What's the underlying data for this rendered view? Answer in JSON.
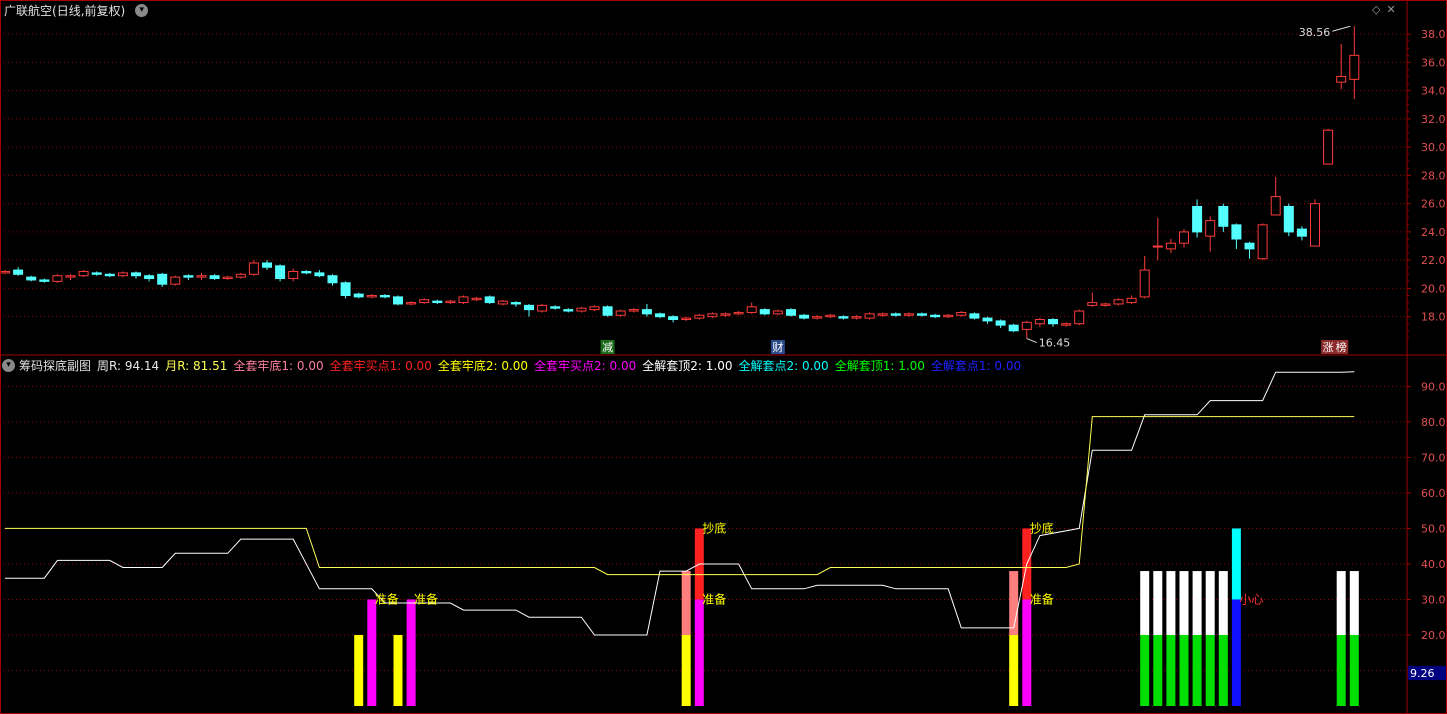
{
  "main_panel": {
    "title": "广联航空",
    "period": "(日线,前复权)",
    "max_label": "38.56",
    "min_label": "16.45",
    "markers": [
      {
        "text": "减",
        "bg": "#1a6b1a",
        "fg": "#ffffff",
        "index": 46
      },
      {
        "text": "财",
        "bg": "#2a4a8a",
        "fg": "#ffffff",
        "index": 59
      },
      {
        "text": "涨",
        "bg": "#8a2a2a",
        "fg": "#ffffff",
        "index": 101
      },
      {
        "text": "榜",
        "bg": "#8a2a2a",
        "fg": "#ffffff",
        "index": 102
      }
    ],
    "y_ticks": [
      "38.0",
      "36.0",
      "34.0",
      "32.0",
      "30.0",
      "28.0",
      "26.0",
      "24.0",
      "22.0",
      "20.0",
      "18.0"
    ]
  },
  "sub_panel": {
    "title": "筹码探底副图",
    "metrics": [
      {
        "label": "周R: 94.14",
        "color": "#e8e8e8"
      },
      {
        "label": "月R: 81.51",
        "color": "#ffff55"
      },
      {
        "label": "全套牢底1: 0.00",
        "color": "#ff7f9f"
      },
      {
        "label": "全套牢买点1: 0.00",
        "color": "#ff2020"
      },
      {
        "label": "全套牢底2: 0.00",
        "color": "#ffff00"
      },
      {
        "label": "全套牢买点2: 0.00",
        "color": "#ff00ff"
      },
      {
        "label": "全解套顶2: 1.00",
        "color": "#ffffff"
      },
      {
        "label": "全解套点2: 0.00",
        "color": "#00ffff"
      },
      {
        "label": "全解套顶1: 1.00",
        "color": "#00ff00"
      },
      {
        "label": "全解套点1: 0.00",
        "color": "#2020ff"
      }
    ],
    "y_ticks": [
      "90.0",
      "80.0",
      "70.0",
      "60.0",
      "50.0",
      "40.0",
      "30.0",
      "20.0"
    ],
    "current_value": "9.26",
    "annotations": [
      {
        "text": "准备",
        "index": 28,
        "y": 30,
        "color": "#ffff00"
      },
      {
        "text": "准备",
        "index": 31,
        "y": 30,
        "color": "#ffff00"
      },
      {
        "text": "抄底",
        "index": 53,
        "y": 50,
        "color": "#ffff00"
      },
      {
        "text": "准备",
        "index": 53,
        "y": 30,
        "color": "#ffff00"
      },
      {
        "text": "抄底",
        "index": 78,
        "y": 50,
        "color": "#ffff00"
      },
      {
        "text": "准备",
        "index": 78,
        "y": 30,
        "color": "#ffff00"
      },
      {
        "text": "小心",
        "index": 94,
        "y": 30,
        "color": "#ff3030"
      }
    ]
  },
  "colors": {
    "up": "#ff3b3b",
    "down": "#54ffff",
    "grid": "#8b0000",
    "axis_text": "#e05050",
    "white_line": "#ffffff",
    "yellow_line": "#ffff55"
  },
  "chart_data": {
    "type": "candlestick",
    "price_ylim": [
      15.5,
      39.0
    ],
    "candles": [
      [
        21.1,
        21.2,
        21.0,
        21.3
      ],
      [
        21.3,
        21.0,
        20.9,
        21.5
      ],
      [
        20.8,
        20.6,
        20.5,
        20.9
      ],
      [
        20.6,
        20.5,
        20.4,
        20.7
      ],
      [
        20.5,
        20.9,
        20.4,
        21.0
      ],
      [
        20.8,
        20.9,
        20.6,
        21.0
      ],
      [
        20.9,
        21.2,
        20.8,
        21.3
      ],
      [
        21.1,
        21.0,
        20.9,
        21.2
      ],
      [
        21.0,
        20.9,
        20.8,
        21.1
      ],
      [
        20.9,
        21.1,
        20.8,
        21.2
      ],
      [
        21.1,
        20.9,
        20.7,
        21.2
      ],
      [
        20.9,
        20.7,
        20.5,
        21.0
      ],
      [
        21.0,
        20.3,
        20.1,
        21.1
      ],
      [
        20.3,
        20.8,
        20.2,
        20.9
      ],
      [
        20.9,
        20.8,
        20.6,
        21.0
      ],
      [
        20.8,
        20.9,
        20.6,
        21.1
      ],
      [
        20.9,
        20.7,
        20.6,
        21.0
      ],
      [
        20.7,
        20.8,
        20.6,
        20.9
      ],
      [
        20.8,
        21.0,
        20.7,
        21.1
      ],
      [
        21.0,
        21.8,
        20.9,
        22.0
      ],
      [
        21.8,
        21.5,
        21.3,
        22.0
      ],
      [
        21.6,
        20.7,
        20.5,
        21.7
      ],
      [
        20.7,
        21.2,
        20.5,
        21.4
      ],
      [
        21.2,
        21.1,
        21.0,
        21.3
      ],
      [
        21.1,
        20.9,
        20.8,
        21.3
      ],
      [
        20.9,
        20.4,
        20.2,
        21.0
      ],
      [
        20.4,
        19.5,
        19.3,
        20.5
      ],
      [
        19.6,
        19.4,
        19.3,
        19.7
      ],
      [
        19.4,
        19.5,
        19.3,
        19.6
      ],
      [
        19.5,
        19.4,
        19.3,
        19.6
      ],
      [
        19.4,
        18.9,
        18.8,
        19.5
      ],
      [
        18.9,
        19.0,
        18.8,
        19.1
      ],
      [
        19.0,
        19.2,
        18.9,
        19.3
      ],
      [
        19.1,
        19.0,
        18.9,
        19.2
      ],
      [
        19.0,
        19.1,
        18.9,
        19.2
      ],
      [
        19.0,
        19.4,
        18.9,
        19.5
      ],
      [
        19.2,
        19.3,
        19.1,
        19.4
      ],
      [
        19.4,
        19.0,
        18.9,
        19.5
      ],
      [
        18.9,
        19.1,
        18.8,
        19.2
      ],
      [
        19.0,
        18.9,
        18.7,
        19.1
      ],
      [
        18.8,
        18.5,
        18.0,
        18.9
      ],
      [
        18.4,
        18.8,
        18.3,
        18.9
      ],
      [
        18.7,
        18.6,
        18.5,
        18.8
      ],
      [
        18.5,
        18.4,
        18.3,
        18.6
      ],
      [
        18.4,
        18.6,
        18.3,
        18.7
      ],
      [
        18.5,
        18.7,
        18.4,
        18.8
      ],
      [
        18.7,
        18.1,
        18.0,
        18.8
      ],
      [
        18.1,
        18.4,
        18.0,
        18.5
      ],
      [
        18.4,
        18.5,
        18.3,
        18.6
      ],
      [
        18.5,
        18.2,
        18.0,
        18.9
      ],
      [
        18.2,
        18.0,
        17.9,
        18.3
      ],
      [
        18.0,
        17.8,
        17.6,
        18.1
      ],
      [
        17.8,
        17.9,
        17.7,
        18.0
      ],
      [
        17.9,
        18.1,
        17.8,
        18.2
      ],
      [
        18.0,
        18.2,
        17.9,
        18.3
      ],
      [
        18.1,
        18.2,
        18.0,
        18.3
      ],
      [
        18.2,
        18.3,
        18.1,
        18.4
      ],
      [
        18.3,
        18.7,
        18.2,
        19.0
      ],
      [
        18.5,
        18.2,
        18.1,
        18.6
      ],
      [
        18.2,
        18.4,
        18.1,
        18.5
      ],
      [
        18.5,
        18.1,
        18.0,
        18.6
      ],
      [
        18.1,
        17.9,
        17.8,
        18.2
      ],
      [
        17.9,
        18.0,
        17.8,
        18.1
      ],
      [
        18.0,
        18.1,
        17.9,
        18.2
      ],
      [
        18.0,
        17.9,
        17.8,
        18.1
      ],
      [
        17.9,
        18.0,
        17.8,
        18.1
      ],
      [
        17.9,
        18.2,
        17.8,
        18.3
      ],
      [
        18.1,
        18.2,
        18.0,
        18.3
      ],
      [
        18.2,
        18.1,
        18.0,
        18.3
      ],
      [
        18.1,
        18.2,
        18.0,
        18.3
      ],
      [
        18.2,
        18.1,
        18.0,
        18.3
      ],
      [
        18.1,
        18.0,
        17.9,
        18.2
      ],
      [
        18.0,
        18.1,
        17.9,
        18.2
      ],
      [
        18.1,
        18.3,
        18.0,
        18.4
      ],
      [
        18.2,
        17.9,
        17.8,
        18.3
      ],
      [
        17.9,
        17.7,
        17.5,
        18.0
      ],
      [
        17.7,
        17.4,
        17.2,
        17.8
      ],
      [
        17.4,
        17.0,
        16.9,
        17.5
      ],
      [
        17.1,
        17.6,
        16.45,
        17.7
      ],
      [
        17.5,
        17.8,
        17.3,
        17.9
      ],
      [
        17.8,
        17.5,
        17.3,
        17.9
      ],
      [
        17.4,
        17.5,
        17.3,
        17.6
      ],
      [
        17.5,
        18.4,
        17.4,
        18.5
      ],
      [
        18.8,
        19.0,
        18.7,
        19.7
      ],
      [
        18.8,
        18.9,
        18.7,
        19.0
      ],
      [
        18.9,
        19.2,
        18.8,
        19.3
      ],
      [
        19.0,
        19.3,
        18.9,
        19.5
      ],
      [
        19.4,
        21.3,
        19.3,
        22.3
      ],
      [
        23.0,
        23.0,
        22.0,
        25.0
      ],
      [
        22.8,
        23.2,
        22.5,
        23.5
      ],
      [
        23.2,
        24.0,
        22.9,
        24.2
      ],
      [
        25.8,
        24.0,
        23.6,
        26.3
      ],
      [
        23.7,
        24.8,
        22.6,
        25.1
      ],
      [
        25.8,
        24.4,
        24.0,
        26.0
      ],
      [
        24.5,
        23.5,
        22.8,
        24.6
      ],
      [
        23.2,
        22.8,
        22.1,
        23.3
      ],
      [
        22.1,
        24.5,
        22.0,
        24.6
      ],
      [
        25.2,
        26.5,
        25.2,
        27.9
      ],
      [
        25.8,
        24.0,
        23.7,
        26.0
      ],
      [
        24.2,
        23.7,
        23.4,
        24.4
      ],
      [
        23.0,
        26.0,
        23.0,
        26.3
      ],
      [
        28.8,
        31.2,
        28.8,
        31.3
      ],
      [
        34.6,
        35.0,
        34.1,
        37.3
      ],
      [
        34.8,
        36.5,
        33.4,
        38.56
      ]
    ],
    "white_line": [
      [
        0,
        36.0
      ],
      [
        3,
        36.0
      ],
      [
        4,
        41.0
      ],
      [
        8,
        41.0
      ],
      [
        9,
        39.0
      ],
      [
        12,
        39.0
      ],
      [
        13,
        43.0
      ],
      [
        17,
        43.0
      ],
      [
        18,
        47.0
      ],
      [
        22,
        47.0
      ],
      [
        24,
        33.0
      ],
      [
        28,
        33.0
      ],
      [
        29,
        29.0
      ],
      [
        34,
        29.0
      ],
      [
        35,
        27.0
      ],
      [
        39,
        27.0
      ],
      [
        40,
        25.0
      ],
      [
        44,
        25.0
      ],
      [
        45,
        20.0
      ],
      [
        49,
        20.0
      ],
      [
        50,
        38.0
      ],
      [
        52,
        38.0
      ],
      [
        53,
        40.0
      ],
      [
        56,
        40.0
      ],
      [
        57,
        33.0
      ],
      [
        61,
        33.0
      ],
      [
        62,
        34.0
      ],
      [
        67,
        34.0
      ],
      [
        68,
        33.0
      ],
      [
        72,
        33.0
      ],
      [
        73,
        22.0
      ],
      [
        77,
        22.0
      ],
      [
        78,
        40.0
      ],
      [
        79,
        48.0
      ],
      [
        82,
        50.0
      ],
      [
        83,
        72.0
      ],
      [
        86,
        72.0
      ],
      [
        87,
        82.0
      ],
      [
        91,
        82.0
      ],
      [
        92,
        86.0
      ],
      [
        96,
        86.0
      ],
      [
        97,
        94.0
      ],
      [
        102,
        94.0
      ],
      [
        103,
        94.14
      ]
    ],
    "yellow_line": [
      [
        0,
        50.0
      ],
      [
        1,
        50.0
      ],
      [
        2,
        50.0
      ],
      [
        23,
        50.0
      ],
      [
        24,
        39.0
      ],
      [
        45,
        39.0
      ],
      [
        46,
        37.0
      ],
      [
        62,
        37.0
      ],
      [
        63,
        39.0
      ],
      [
        81,
        39.0
      ],
      [
        82,
        40.0
      ],
      [
        83,
        81.51
      ],
      [
        103,
        81.51
      ]
    ],
    "bars": [
      {
        "index": 27,
        "from": 0,
        "to": 20,
        "color": "#ffff00"
      },
      {
        "index": 28,
        "from": 0,
        "to": 30,
        "color": "#ff00ff"
      },
      {
        "index": 30,
        "from": 0,
        "to": 20,
        "color": "#ffff00"
      },
      {
        "index": 31,
        "from": 0,
        "to": 30,
        "color": "#ff00ff"
      },
      {
        "index": 52,
        "from": 0,
        "to": 20,
        "color": "#ffff00"
      },
      {
        "index": 52,
        "from": 20,
        "to": 38,
        "color": "#ff7f7f"
      },
      {
        "index": 53,
        "from": 0,
        "to": 30,
        "color": "#ff00ff"
      },
      {
        "index": 53,
        "from": 30,
        "to": 50,
        "color": "#ff2020"
      },
      {
        "index": 77,
        "from": 0,
        "to": 20,
        "color": "#ffff00"
      },
      {
        "index": 77,
        "from": 20,
        "to": 38,
        "color": "#ff7f7f"
      },
      {
        "index": 78,
        "from": 0,
        "to": 30,
        "color": "#ff00ff"
      },
      {
        "index": 78,
        "from": 30,
        "to": 50,
        "color": "#ff2020"
      },
      {
        "index": 87,
        "from": 0,
        "to": 20,
        "color": "#00e000"
      },
      {
        "index": 87,
        "from": 20,
        "to": 38,
        "color": "#ffffff"
      },
      {
        "index": 88,
        "from": 0,
        "to": 20,
        "color": "#00e000"
      },
      {
        "index": 88,
        "from": 20,
        "to": 38,
        "color": "#ffffff"
      },
      {
        "index": 89,
        "from": 0,
        "to": 20,
        "color": "#00e000"
      },
      {
        "index": 89,
        "from": 20,
        "to": 38,
        "color": "#ffffff"
      },
      {
        "index": 90,
        "from": 0,
        "to": 20,
        "color": "#00e000"
      },
      {
        "index": 90,
        "from": 20,
        "to": 38,
        "color": "#ffffff"
      },
      {
        "index": 91,
        "from": 0,
        "to": 20,
        "color": "#00e000"
      },
      {
        "index": 91,
        "from": 20,
        "to": 38,
        "color": "#ffffff"
      },
      {
        "index": 92,
        "from": 0,
        "to": 20,
        "color": "#00e000"
      },
      {
        "index": 92,
        "from": 20,
        "to": 38,
        "color": "#ffffff"
      },
      {
        "index": 93,
        "from": 0,
        "to": 20,
        "color": "#00e000"
      },
      {
        "index": 93,
        "from": 20,
        "to": 38,
        "color": "#ffffff"
      },
      {
        "index": 94,
        "from": 0,
        "to": 30,
        "color": "#1010ff"
      },
      {
        "index": 94,
        "from": 30,
        "to": 50,
        "color": "#00ffff"
      },
      {
        "index": 102,
        "from": 0,
        "to": 20,
        "color": "#00e000"
      },
      {
        "index": 102,
        "from": 20,
        "to": 38,
        "color": "#ffffff"
      },
      {
        "index": 103,
        "from": 0,
        "to": 20,
        "color": "#00e000"
      },
      {
        "index": 103,
        "from": 20,
        "to": 38,
        "color": "#ffffff"
      }
    ],
    "indicator_ylim": [
      0,
      98
    ]
  }
}
